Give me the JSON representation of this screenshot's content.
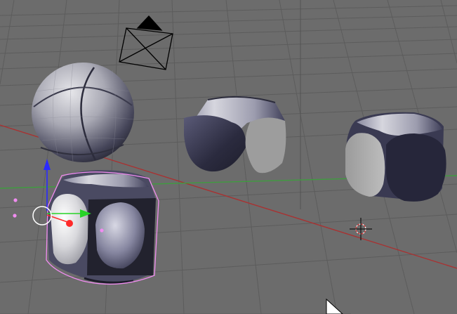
{
  "viewport": {
    "type": "3d-view",
    "background_color": "#6c6c6c",
    "grid_color": "#5a5a5a",
    "x_axis_color": "#a83232",
    "y_axis_color": "#3f9c3f",
    "selection_outline_color": "#f08cf0",
    "manipulator_colors": {
      "x": "#ff2a2a",
      "y": "#27d427",
      "z": "#2a2aff"
    }
  },
  "objects": [
    {
      "name": "camera",
      "kind": "camera",
      "selected": false
    },
    {
      "name": "sphere",
      "kind": "mesh",
      "selected": false
    },
    {
      "name": "cut-cylinder",
      "kind": "mesh",
      "selected": false
    },
    {
      "name": "rounded-cube",
      "kind": "mesh",
      "selected": false
    },
    {
      "name": "active-object",
      "kind": "mesh",
      "selected": true
    }
  ],
  "cursor": {
    "icon": "3d-cursor-icon"
  },
  "mouse": {
    "icon": "mouse-pointer-icon"
  }
}
